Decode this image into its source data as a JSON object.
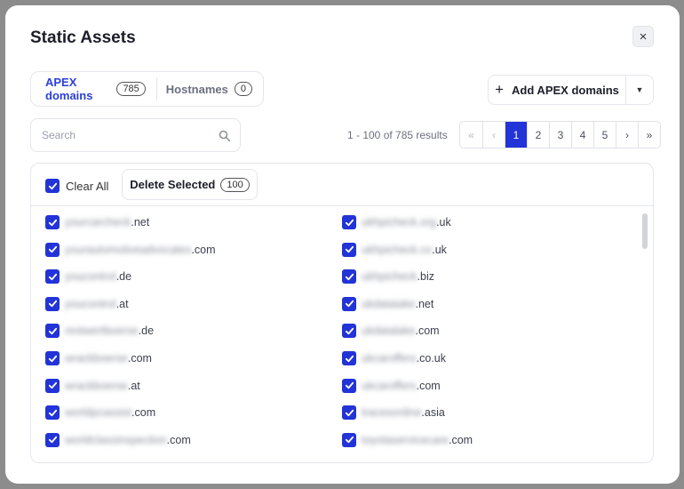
{
  "modal": {
    "title": "Static Assets",
    "close_label": "×"
  },
  "tabs": [
    {
      "label": "APEX domains",
      "count": "785"
    },
    {
      "label": "Hostnames",
      "count": "0"
    }
  ],
  "add_button": {
    "label": "Add APEX domains",
    "plus": "+",
    "caret": "▼"
  },
  "search": {
    "placeholder": "Search"
  },
  "results_text": "1 - 100 of 785 results",
  "pagination": [
    "«",
    "‹",
    "1",
    "2",
    "3",
    "4",
    "5",
    "›",
    "»"
  ],
  "clear_all_label": "Clear All",
  "delete_selected": {
    "label": "Delete Selected",
    "count": "100"
  },
  "domains_left": [
    {
      "blurred": "yourcarcheck",
      "suffix": ".net"
    },
    {
      "blurred": "yourautomotiveadvocates",
      "suffix": ".com"
    },
    {
      "blurred": "youcontrol",
      "suffix": ".de"
    },
    {
      "blurred": "youcontrol",
      "suffix": ".at"
    },
    {
      "blurred": "restwertboerse",
      "suffix": ".de"
    },
    {
      "blurred": "wrackboerse",
      "suffix": ".com"
    },
    {
      "blurred": "wrackboerse",
      "suffix": ".at"
    },
    {
      "blurred": "worldpcassist",
      "suffix": ".com"
    },
    {
      "blurred": "worldclassinspection",
      "suffix": ".com"
    }
  ],
  "domains_right": [
    {
      "blurred": "ukhpicheck.org",
      "suffix": ".uk"
    },
    {
      "blurred": "ukhpicheck.co",
      "suffix": ".uk"
    },
    {
      "blurred": "ukhpicheck",
      "suffix": ".biz"
    },
    {
      "blurred": "ukdataiake",
      "suffix": ".net"
    },
    {
      "blurred": "ukdatalake",
      "suffix": ".com"
    },
    {
      "blurred": "ukcaroffers",
      "suffix": ".co.uk"
    },
    {
      "blurred": "ukcaroffers",
      "suffix": ".com"
    },
    {
      "blurred": "tracesonline",
      "suffix": ".asia"
    },
    {
      "blurred": "toyotaservicecare",
      "suffix": ".com"
    }
  ],
  "colors": {
    "accent": "#2233d8",
    "tab_active": "#2a3fd6"
  }
}
